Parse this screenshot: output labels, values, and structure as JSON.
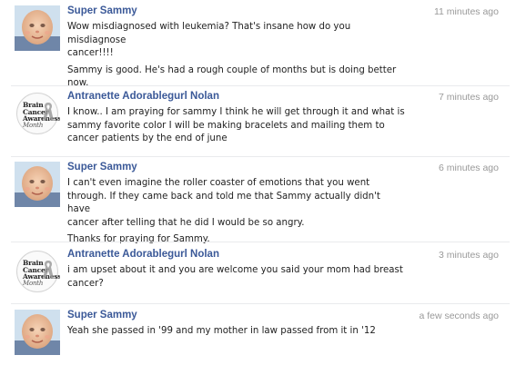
{
  "messages": [
    {
      "author": "Super Sammy",
      "avatar": "sammy-profile-photo",
      "time": "11 minutes ago",
      "paragraphs": [
        "Wow misdiagnosed with leukemia? That's insane how do you misdiagnose\ncancer!!!!",
        "Sammy is good. He's had a rough couple of months but is doing better\nnow."
      ]
    },
    {
      "author": "Antranette Adorablegurl Nolan",
      "avatar": "brain-cancer-awareness-month-badge",
      "time": "7 minutes ago",
      "paragraphs": [
        "I know.. I am praying for sammy I think he will get through it and what is\nsammy favorite color I will be making bracelets and mailing them to\ncancer patients by the end of june"
      ]
    },
    {
      "author": "Super Sammy",
      "avatar": "sammy-profile-photo",
      "time": "6 minutes ago",
      "paragraphs": [
        "I can't even imagine the roller coaster of emotions that you went\nthrough. If they came back and told me that Sammy actually didn't have\ncancer after telling that he did I would be so angry.",
        "Thanks for praying for Sammy."
      ]
    },
    {
      "author": "Antranette Adorablegurl Nolan",
      "avatar": "brain-cancer-awareness-month-badge",
      "time": "3 minutes ago",
      "paragraphs": [
        "i am upset about it and you are welcome you said your mom had breast\ncancer?"
      ]
    },
    {
      "author": "Super Sammy",
      "avatar": "sammy-profile-photo",
      "time": "a few seconds ago",
      "paragraphs": [
        "Yeah she passed in '99 and my mother in law passed from it in '12"
      ]
    }
  ],
  "badge": {
    "lines": [
      "Brain",
      "Cancer",
      "Awareness",
      "Month"
    ]
  },
  "colors": {
    "author_link": "#3b5998",
    "timestamp": "#999999",
    "body_text": "#222222",
    "divider": "#e9eaed",
    "ribbon": "#9a9a9a"
  }
}
